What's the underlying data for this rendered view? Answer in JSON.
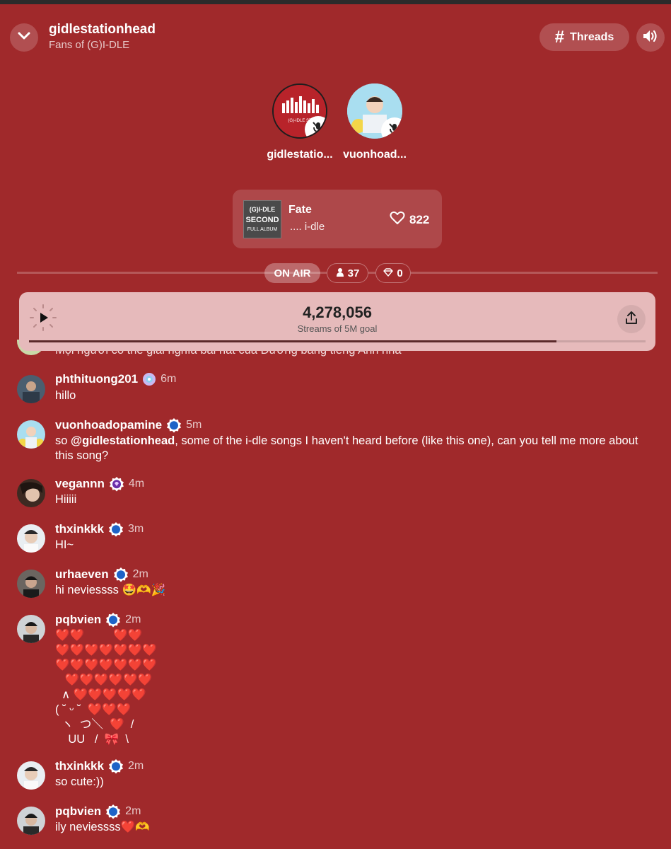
{
  "header": {
    "title": "gidlestationhead",
    "subtitle": "Fans of (G)I-DLE",
    "threads_label": "Threads"
  },
  "hosts": [
    {
      "name": "gidlestatio...",
      "avatar_text": "(G)-IDLE ST"
    },
    {
      "name": "vuonhoad..."
    }
  ],
  "now_playing": {
    "title": "Fate",
    "artist": "....  i-dle",
    "likes": "822",
    "album_text_1": "(G)I-DLE",
    "album_text_2": "SECOND",
    "album_text_3": "FULL ALBUM"
  },
  "status": {
    "on_air": "ON AIR",
    "listeners": "37",
    "gems": "0"
  },
  "goal": {
    "count": "4,278,056",
    "label": "Streams of 5M goal",
    "progress": 0.856
  },
  "partial_message": "Mọi người có thể giải nghĩa bài hát của Dương bằng tiếng Anh nha",
  "messages": [
    {
      "user": "phthituong201",
      "time": "6m",
      "text": "hillo"
    },
    {
      "user": "vuonhoadopamine",
      "time": "5m",
      "text_pre": "so ",
      "mention": "@gidlestationhead",
      "text_post": ", some of the i-dle songs I haven't heard before (like this one), can you tell me more about this song?"
    },
    {
      "user": "vegannn",
      "time": "4m",
      "text": "Hiiiii"
    },
    {
      "user": "thxinkkk",
      "time": "3m",
      "text": "HI~"
    },
    {
      "user": "urhaeven",
      "time": "2m",
      "text": "hi neviessss 🤩🫶🎉"
    },
    {
      "user": "pqbvien",
      "time": "2m",
      "text": "❤️❤️         ❤️❤️\n❤️❤️❤️❤️❤️❤️❤️\n❤️❤️❤️❤️❤️❤️❤️\n   ❤️❤️❤️❤️❤️❤️\n  ∧ ❤️❤️❤️❤️❤️\n( ˘ ᵕ ˘  ❤️❤️❤️\n  ヽ  つ＼  ❤️  /\n    UU   /  🎀  \\"
    },
    {
      "user": "thxinkkk",
      "time": "2m",
      "text": "so cute:))"
    },
    {
      "user": "pqbvien",
      "time": "2m",
      "text": "ily neviessss❤️🫶"
    }
  ],
  "colors": {
    "background": "#a0292b",
    "goal_bar": "#e6babb",
    "verified_badge": "#1e63c7",
    "purple_badge": "#6b2fa8"
  }
}
